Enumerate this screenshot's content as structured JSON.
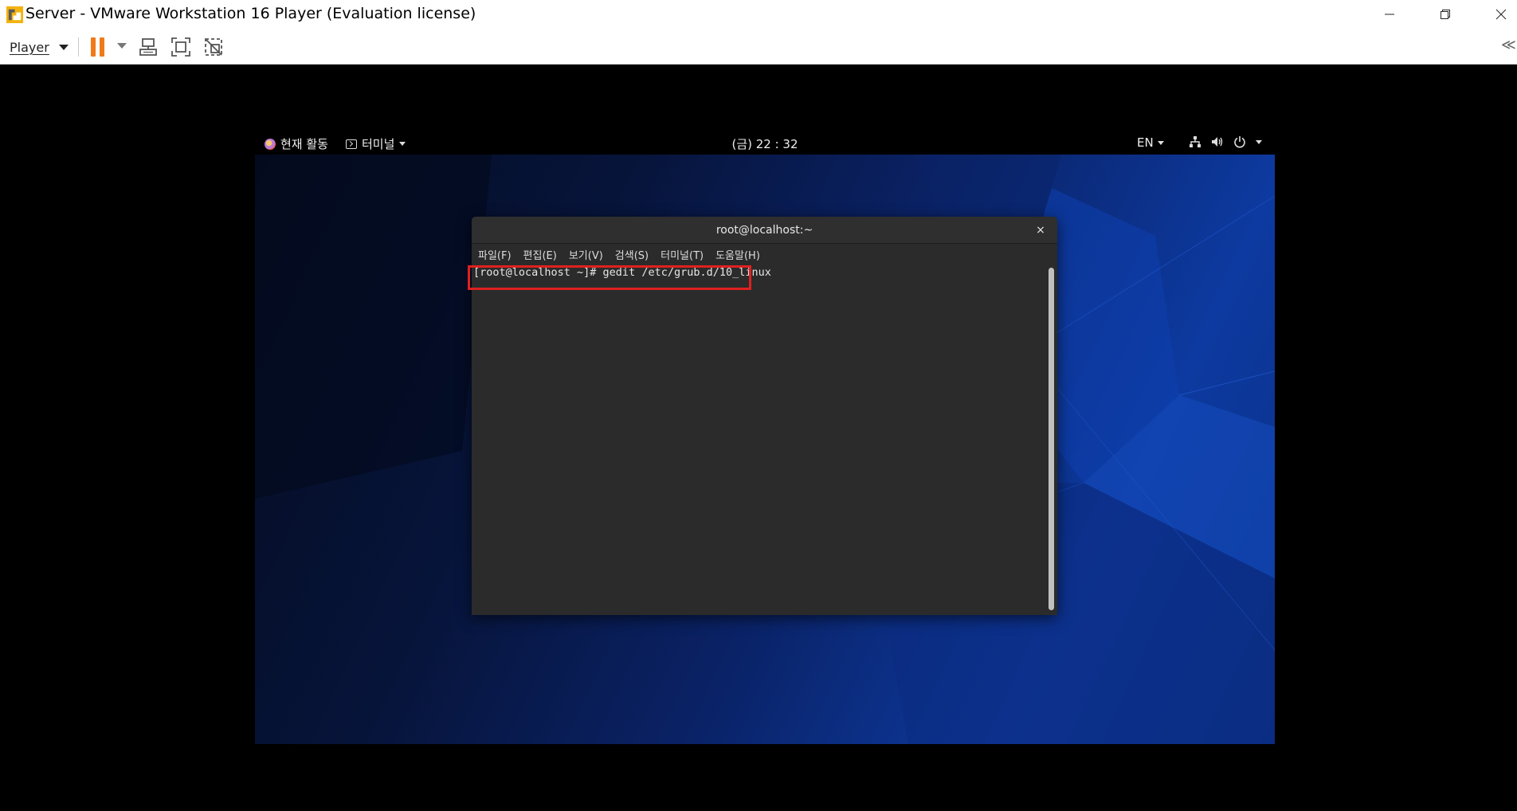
{
  "window": {
    "title": "Server - VMware Workstation 16 Player (Evaluation license)",
    "app_icon": "vmware-icon",
    "controls": [
      "minimize-icon",
      "restore-icon",
      "close-icon"
    ]
  },
  "toolbar": {
    "player_label": "Player",
    "icons": [
      "pause-icon",
      "send-ctrl-alt-del-icon",
      "fullscreen-icon",
      "unity-icon"
    ],
    "accent_color": "#f07a1a",
    "collapse_label": "≪"
  },
  "gnome_bar": {
    "activities_label": "현재 활동",
    "app_menu_label": "터미널",
    "clock": "(금) 22 : 32",
    "input_method": "EN",
    "status_icons": [
      "network-icon",
      "volume-icon",
      "power-icon"
    ]
  },
  "terminal": {
    "title": "root@localhost:~",
    "close_label": "×",
    "menu": [
      "파일(F)",
      "편집(E)",
      "보기(V)",
      "검색(S)",
      "터미널(T)",
      "도움말(H)"
    ],
    "prompt_line": "[root@localhost ~]# gedit /etc/grub.d/10_linux"
  },
  "colors": {
    "highlight": "#e02020",
    "terminal_bg": "#2b2b2b",
    "desktop": "#0d3aa0"
  }
}
